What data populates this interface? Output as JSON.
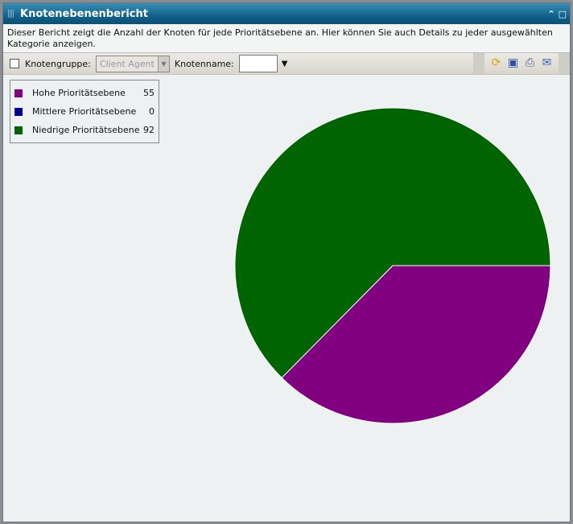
{
  "window": {
    "title": "Knotenebenenbericht",
    "description": "Dieser Bericht zeigt die Anzahl der Knoten für jede Prioritätsebene an. Hier können Sie auch Details zu jeder ausgewählten Kategorie anzeigen."
  },
  "toolbar": {
    "group_label": "Knotengruppe:",
    "group_value": "Client Agent",
    "name_label": "Knotenname:",
    "name_value": "",
    "icons": [
      "refresh-icon",
      "save-icon",
      "print-icon",
      "email-icon"
    ]
  },
  "chart_data": {
    "type": "pie",
    "categories": [
      "Hohe Prioritätsebene",
      "Mittlere Prioritätsebene",
      "Niedrige Prioritätsebene"
    ],
    "values": [
      55,
      0,
      92
    ],
    "colors": [
      "#800080",
      "#00008b",
      "#006400"
    ],
    "legend": "top-left"
  }
}
